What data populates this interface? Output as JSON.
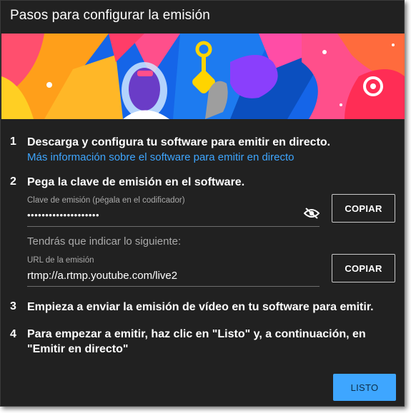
{
  "dialog": {
    "title": "Pasos para configurar la emisión"
  },
  "steps": [
    {
      "number": "1",
      "text": "Descarga y configura tu software para emitir en directo.",
      "link": "Más información sobre el software para emitir en directo"
    },
    {
      "number": "2",
      "text": "Pega la clave de emisión en el software."
    },
    {
      "number": "3",
      "text": "Empieza a enviar la emisión de vídeo en tu software para emitir."
    },
    {
      "number": "4",
      "text": "Para empezar a emitir, haz clic en \"Listo\" y, a continuación, en \"Emitir en directo\""
    }
  ],
  "stream_key": {
    "label": "Clave de emisión (pégala en el codificador)",
    "value": "••••••••••••••••••••",
    "visibility_icon": "eye-off-icon",
    "copy_label": "COPIAR"
  },
  "also_needed": "Tendrás que indicar lo siguiente:",
  "stream_url": {
    "label": "URL de la emisión",
    "value": "rtmp://a.rtmp.youtube.com/live2",
    "copy_label": "COPIAR"
  },
  "done_label": "LISTO",
  "colors": {
    "background": "#212121",
    "link": "#3ea6ff",
    "primary_button": "#3ea6ff"
  }
}
